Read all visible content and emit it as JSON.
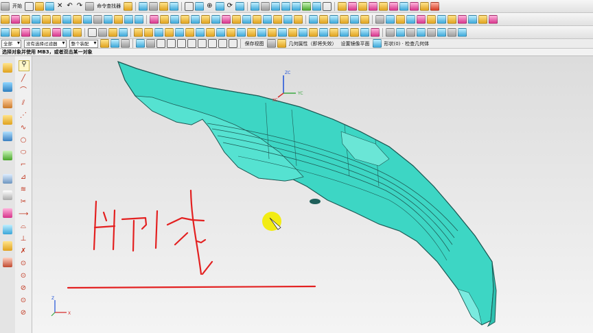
{
  "menu": {
    "start_label": "开始",
    "cmd_finder_label": "命令查找器"
  },
  "selection_bar": {
    "filter_value": "全部",
    "type_filter": "没有选择过滤器",
    "scope_value": "整个装配",
    "save_view": "保存视图",
    "geom_prop": "几何属性（即将失效）",
    "set_mirror": "设置镜像平面",
    "shape_check": "形状(0) · 检查几何体"
  },
  "status_hint": "选择对象并使用 MB3，或者双击某一对象",
  "triad": {
    "zc": "ZC",
    "yc": "YC",
    "xc": "XC",
    "z": "Z",
    "x": "X"
  },
  "annotation": {
    "stroke_color": "#e32020"
  },
  "model": {
    "fill_color": "#3dd6c4",
    "edge_color": "#1e5a55"
  }
}
